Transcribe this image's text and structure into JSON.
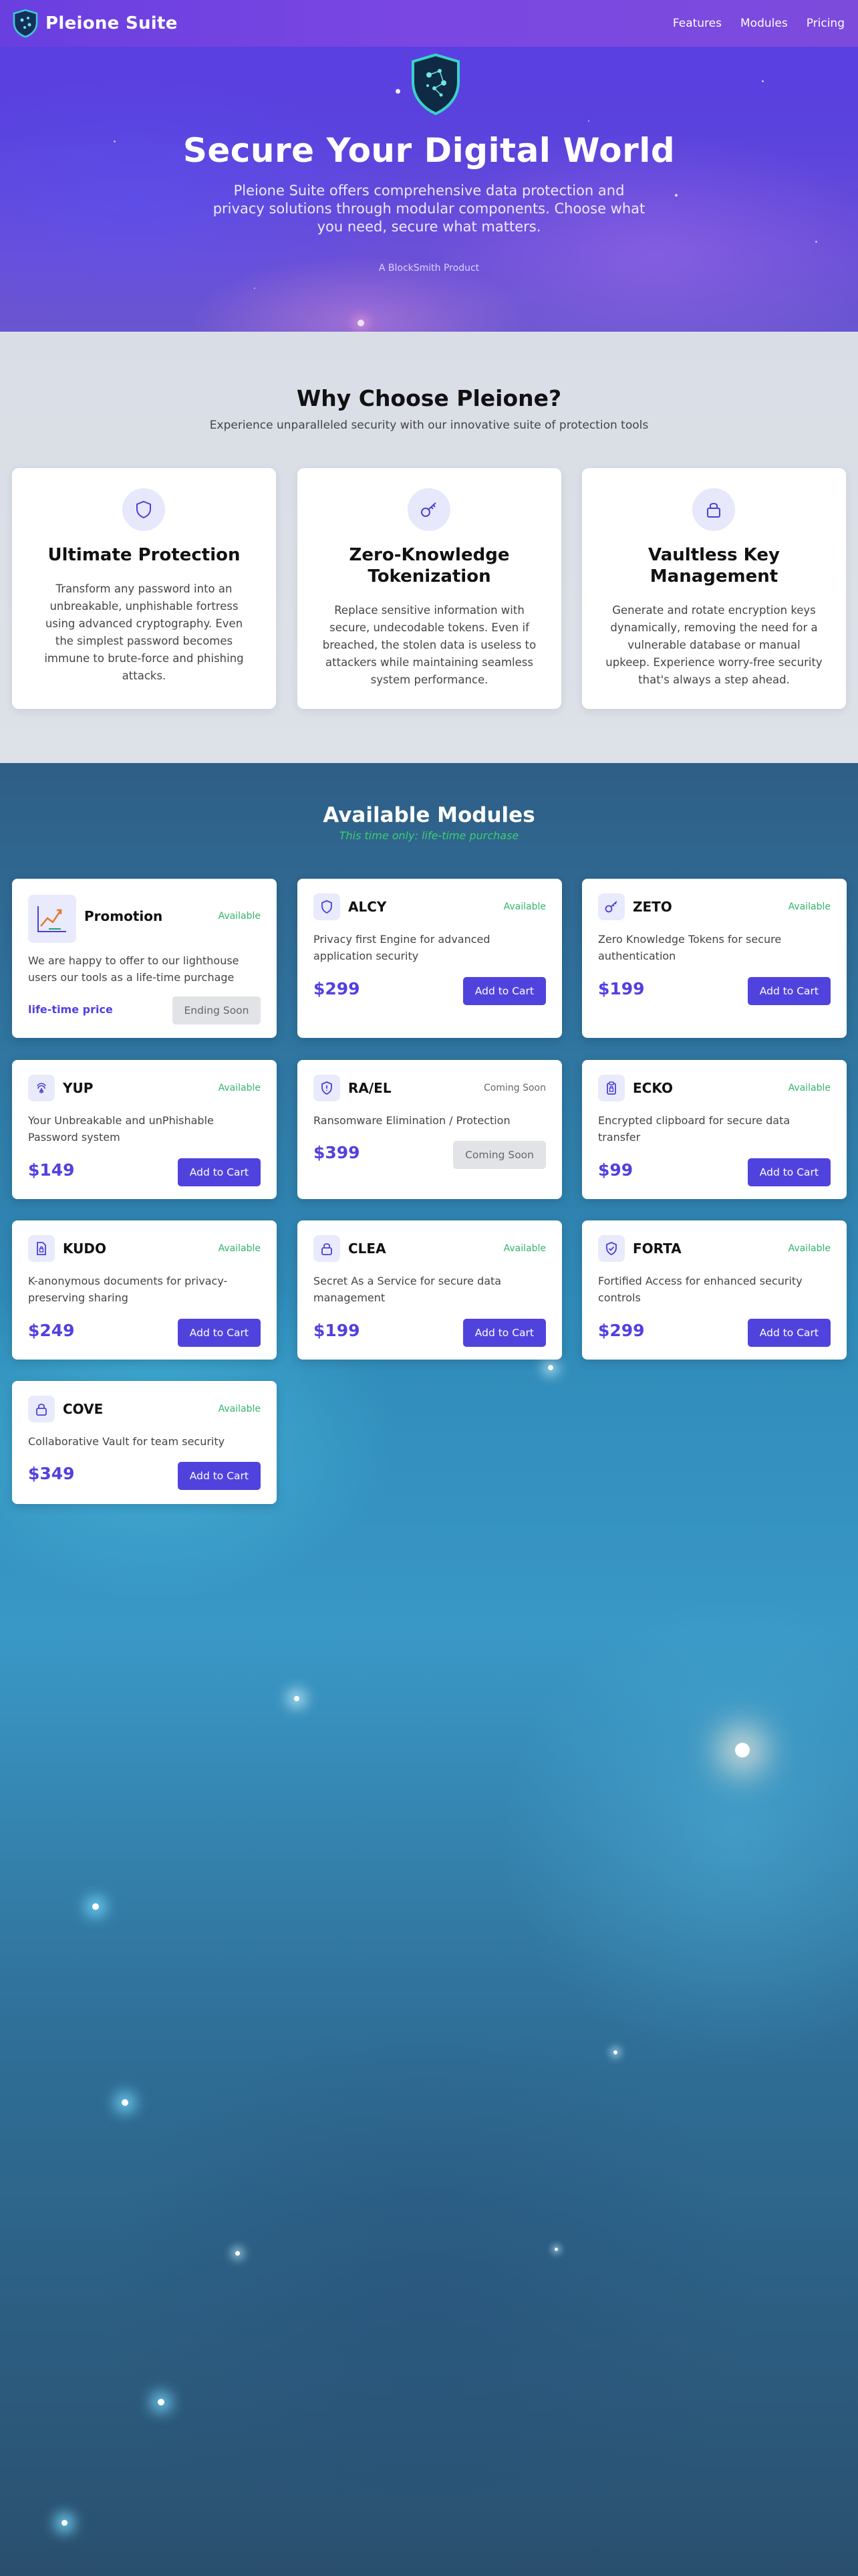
{
  "nav": {
    "brand": "Pleione Suite",
    "links": [
      "Features",
      "Modules",
      "Pricing"
    ]
  },
  "hero": {
    "title": "Secure Your Digital World",
    "subtitle": "Pleione Suite offers comprehensive data protection and privacy solutions through modular components. Choose what you need, secure what matters.",
    "byline": "A BlockSmith Product"
  },
  "why": {
    "title": "Why Choose Pleione?",
    "subtitle": "Experience unparalleled security with our innovative suite of protection tools",
    "features": [
      {
        "icon": "shield-icon",
        "title": "Ultimate Protection",
        "text": "Transform any password into an unbreakable, unphishable fortress using advanced cryptography. Even the simplest password becomes immune to brute-force and phishing attacks."
      },
      {
        "icon": "key-icon",
        "title": "Zero-Knowledge Tokenization",
        "text": "Replace sensitive information with secure, undecodable tokens. Even if breached, the stolen data is useless to attackers while maintaining seamless system performance."
      },
      {
        "icon": "lock-icon",
        "title": "Vaultless Key Management",
        "text": "Generate and rotate encryption keys dynamically, removing the need for a vulnerable database or manual upkeep. Experience worry-free security that's always a step ahead."
      }
    ]
  },
  "modules": {
    "title": "Available Modules",
    "subtitle": "This time only: life-time purchase",
    "promotion": {
      "name": "Promotion",
      "status": "Available",
      "description": "We are happy to offer to our lighthouse users our tools as a life-time purchage",
      "price_label": "life-time price",
      "button": "Ending Soon"
    },
    "items": [
      {
        "name": "ALCY",
        "icon": "shield-icon",
        "status": "Available",
        "description": "Privacy first Engine for advanced application security",
        "price": "$299",
        "button": "Add to Cart"
      },
      {
        "name": "ZETO",
        "icon": "key-icon",
        "status": "Available",
        "description": "Zero Knowledge Tokens for secure authentication",
        "price": "$199",
        "button": "Add to Cart"
      },
      {
        "name": "YUP",
        "icon": "fingerprint-icon",
        "status": "Available",
        "description": "Your Unbreakable and unPhishable Password system",
        "price": "$149",
        "button": "Add to Cart"
      },
      {
        "name": "RA/EL",
        "icon": "shield-alert-icon",
        "status": "Coming Soon",
        "description": "Ransomware Elimination / Protection",
        "price": "$399",
        "button": "Coming Soon"
      },
      {
        "name": "ECKO",
        "icon": "clipboard-lock-icon",
        "status": "Available",
        "description": "Encrypted clipboard for secure data transfer",
        "price": "$99",
        "button": "Add to Cart"
      },
      {
        "name": "KUDO",
        "icon": "document-lock-icon",
        "status": "Available",
        "description": "K-anonymous documents for privacy-preserving sharing",
        "price": "$249",
        "button": "Add to Cart"
      },
      {
        "name": "CLEA",
        "icon": "lock-icon",
        "status": "Available",
        "description": "Secret As a Service for secure data management",
        "price": "$199",
        "button": "Add to Cart"
      },
      {
        "name": "FORTA",
        "icon": "shield-check-icon",
        "status": "Available",
        "description": "Fortified Access for enhanced security controls",
        "price": "$299",
        "button": "Add to Cart"
      },
      {
        "name": "COVE",
        "icon": "lock-icon",
        "status": "Available",
        "description": "Collaborative Vault for team security",
        "price": "$349",
        "button": "Add to Cart"
      }
    ]
  },
  "colors": {
    "accent": "#5043dd",
    "available": "#32b56a",
    "hero_purple": "#5a42dd"
  }
}
